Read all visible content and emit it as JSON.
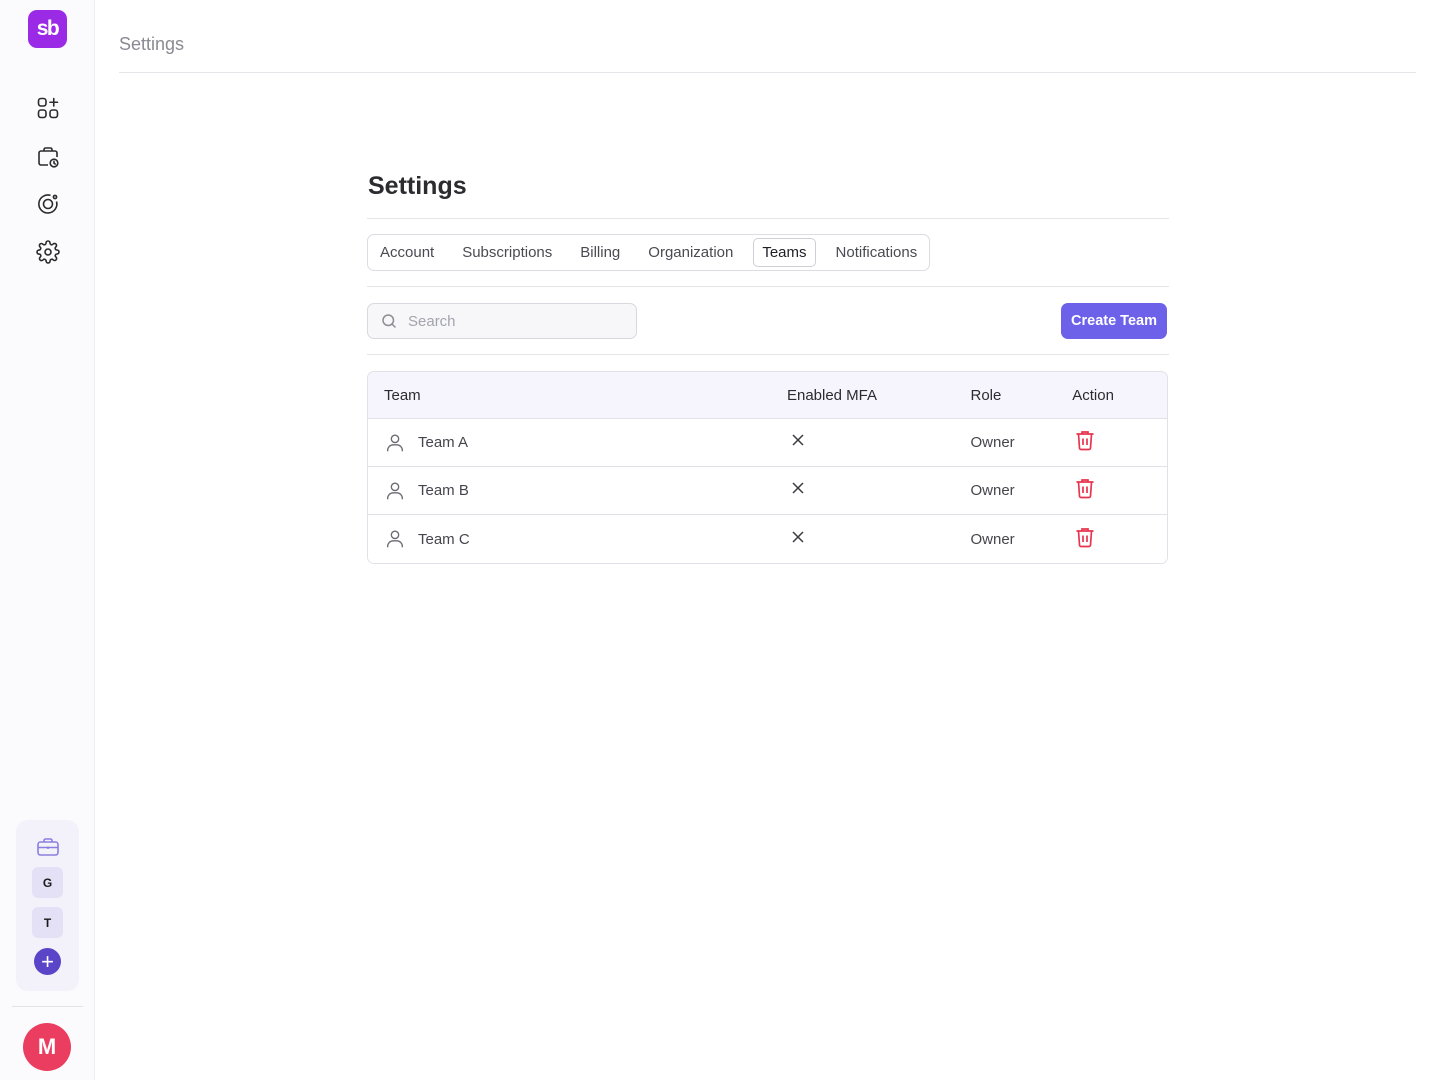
{
  "app": {
    "logo_text": "sb"
  },
  "sidebar": {
    "nav": [
      {
        "icon": "dashboard-add-icon"
      },
      {
        "icon": "briefcase-clock-icon"
      },
      {
        "icon": "target-icon"
      },
      {
        "icon": "gear-icon"
      }
    ],
    "workspaces": [
      {
        "letter": "G"
      },
      {
        "letter": "T"
      }
    ],
    "user_initial": "M"
  },
  "topbar": {
    "title": "Settings"
  },
  "page": {
    "title": "Settings",
    "tabs": [
      {
        "label": "Account",
        "active": false
      },
      {
        "label": "Subscriptions",
        "active": false
      },
      {
        "label": "Billing",
        "active": false
      },
      {
        "label": "Organization",
        "active": false
      },
      {
        "label": "Teams",
        "active": true
      },
      {
        "label": "Notifications",
        "active": false
      }
    ],
    "search": {
      "placeholder": "Search"
    },
    "create_button": "Create Team",
    "table": {
      "headers": [
        "Team",
        "Enabled MFA",
        "Role",
        "Action"
      ],
      "rows": [
        {
          "team": "Team A",
          "mfa": false,
          "role": "Owner"
        },
        {
          "team": "Team B",
          "mfa": false,
          "role": "Owner"
        },
        {
          "team": "Team C",
          "mfa": false,
          "role": "Owner"
        }
      ]
    }
  },
  "colors": {
    "brand": "#9b2ae6",
    "primary_button": "#6d61ea",
    "danger": "#e8354f",
    "avatar": "#ea3d5f"
  }
}
